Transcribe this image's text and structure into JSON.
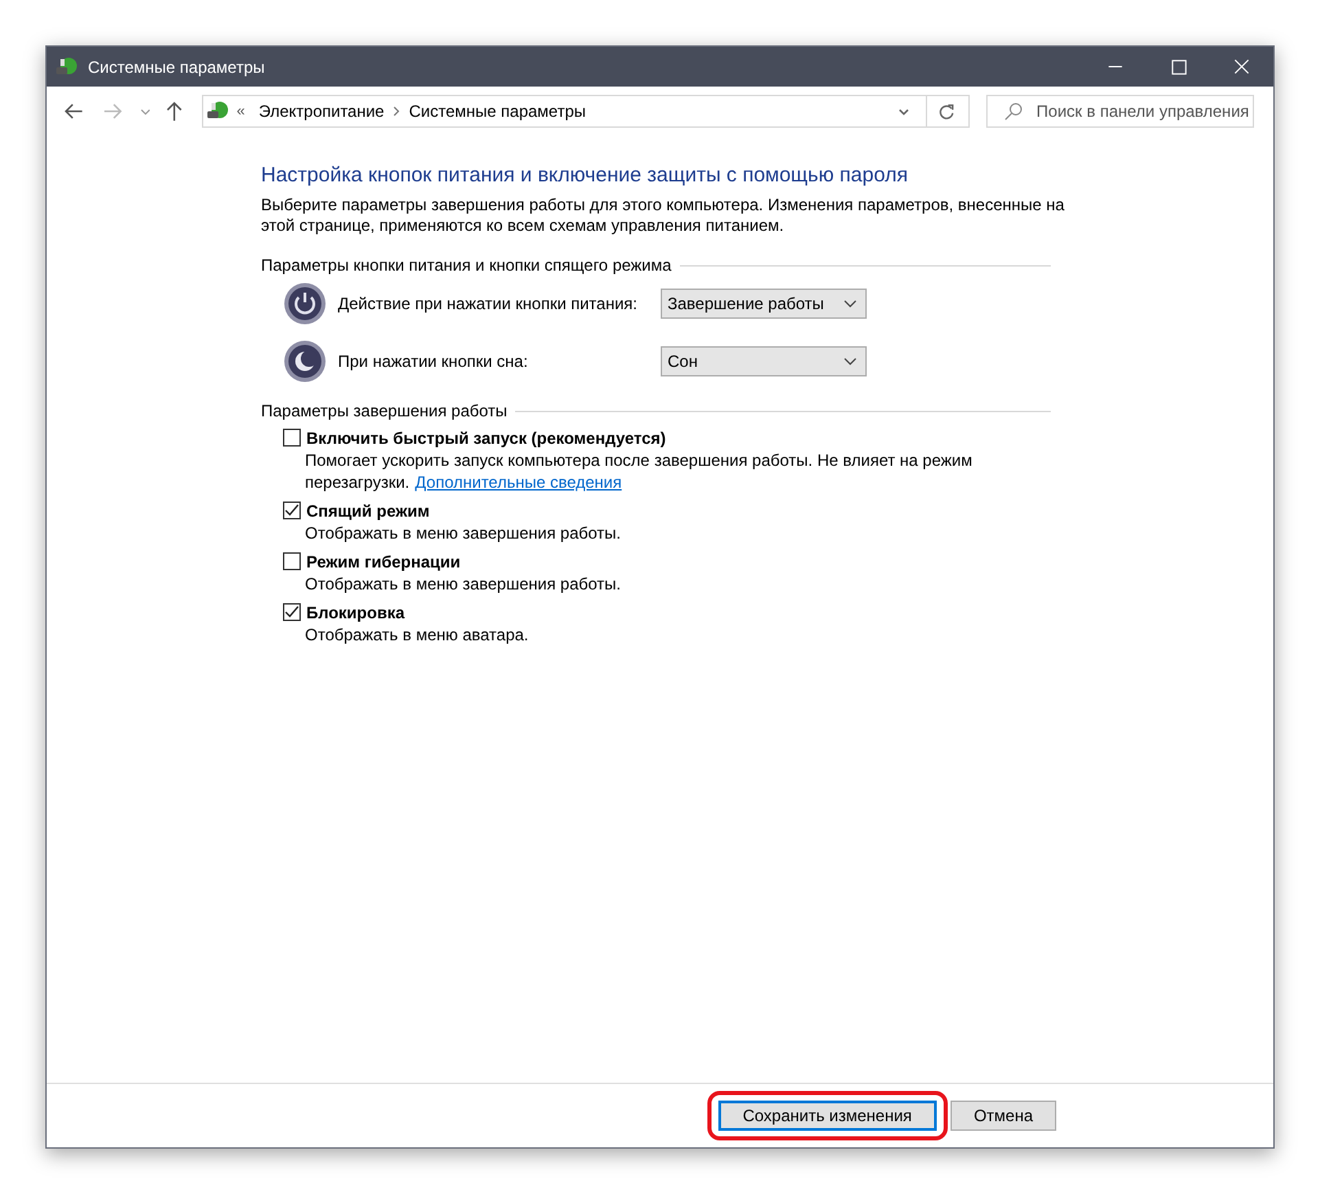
{
  "window": {
    "title": "Системные параметры"
  },
  "address_bar": {
    "breadcrumbs": [
      {
        "label": "«"
      },
      {
        "label": "Электропитание"
      },
      {
        "label": "Системные параметры"
      }
    ]
  },
  "search": {
    "placeholder": "Поиск в панели управления"
  },
  "heading": "Настройка кнопок питания и включение защиты с помощью пароля",
  "description": "Выберите параметры завершения работы для этого компьютера. Изменения параметров, внесенные на этой странице, применяются ко всем схемам управления питанием.",
  "button_section": {
    "title": "Параметры кнопки питания и кнопки спящего режима",
    "rows": [
      {
        "kind": "power",
        "label": "Действие при нажатии кнопки питания:",
        "value": "Завершение работы"
      },
      {
        "kind": "sleep",
        "label": "При нажатии кнопки сна:",
        "value": "Сон"
      }
    ]
  },
  "shutdown_section": {
    "title": "Параметры завершения работы",
    "options": [
      {
        "label": "Включить быстрый запуск (рекомендуется)",
        "checked": false,
        "description": "Помогает ускорить запуск компьютера после завершения работы. Не влияет на режим перезагрузки.",
        "link": "Дополнительные сведения"
      },
      {
        "label": "Спящий режим",
        "checked": true,
        "description": "Отображать в меню завершения работы."
      },
      {
        "label": "Режим гибернации",
        "checked": false,
        "description": "Отображать в меню завершения работы."
      },
      {
        "label": "Блокировка",
        "checked": true,
        "description": "Отображать в меню аватара."
      }
    ]
  },
  "buttons": [
    {
      "label": "Сохранить изменения",
      "default": true,
      "highlighted": true
    },
    {
      "label": "Отмена",
      "default": false,
      "highlighted": false
    }
  ]
}
